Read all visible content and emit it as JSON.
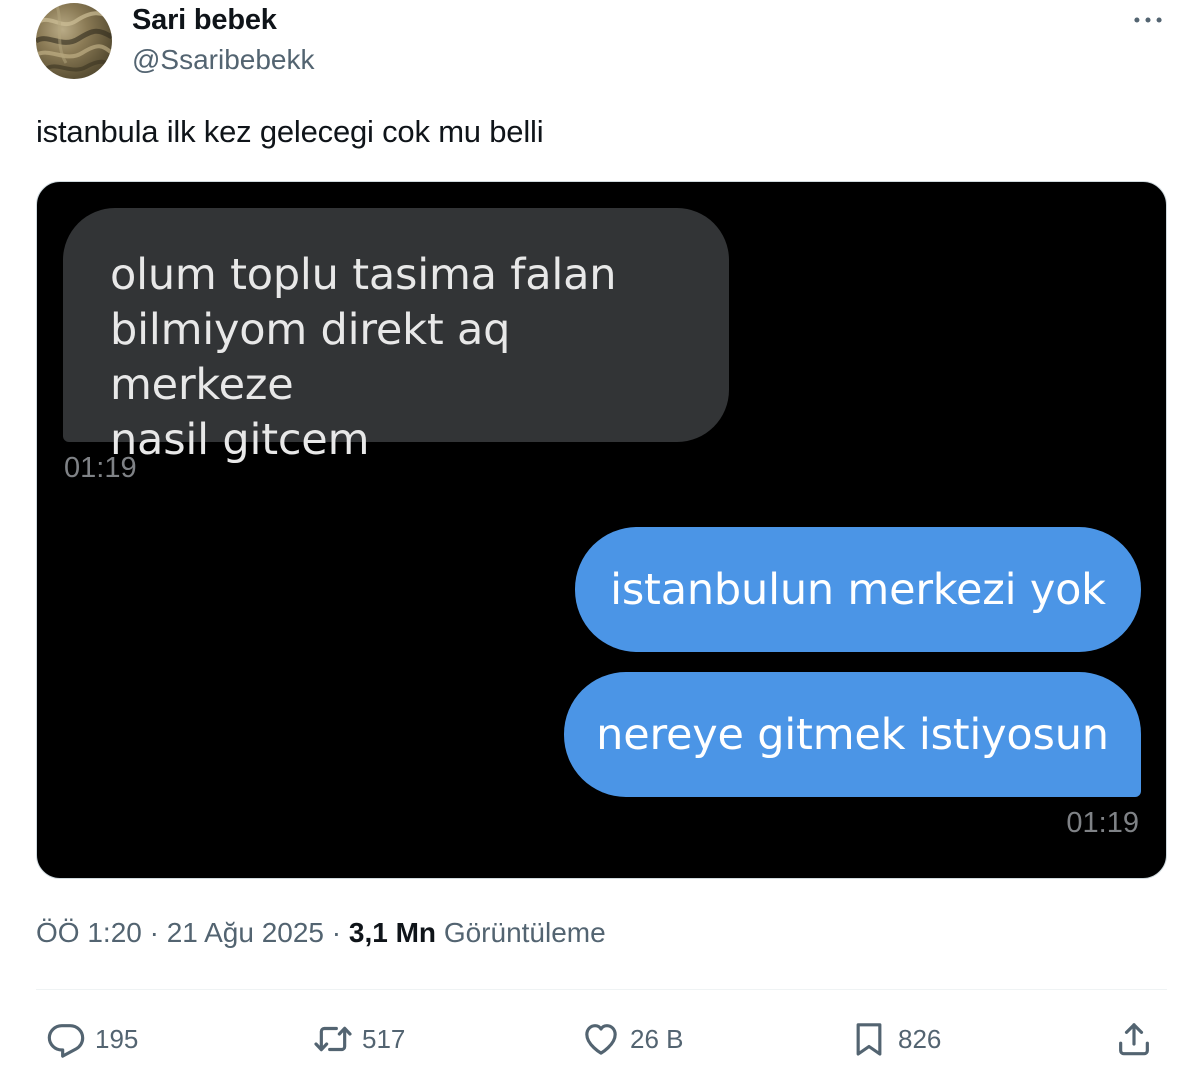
{
  "author": {
    "name": "Sari bebek",
    "handle": "@Ssaribebekk"
  },
  "tweet": {
    "text": "istanbula ilk kez gelecegi cok mu belli"
  },
  "chat": {
    "incoming": {
      "lines": [
        "olum toplu tasima falan",
        "bilmiyom direkt aq merkeze",
        "nasil gitcem"
      ],
      "time": "01:19"
    },
    "outgoing": [
      {
        "text": "istanbulun merkezi yok"
      },
      {
        "text": "nereye gitmek istiyosun"
      }
    ],
    "outgoing_time": "01:19",
    "colors": {
      "incoming_bubble": "#323436",
      "outgoing_bubble": "#4b95e6",
      "background": "#000000"
    }
  },
  "meta": {
    "time": "ÖÖ 1:20",
    "separator": "·",
    "date": "21 Ağu 2025",
    "views_count": "3,1 Mn",
    "views_label": "Görüntüleme"
  },
  "actions": {
    "replies": "195",
    "retweets": "517",
    "likes": "26 B",
    "bookmarks": "826"
  },
  "icons": [
    "more-icon",
    "reply-icon",
    "retweet-icon",
    "like-icon",
    "bookmark-icon",
    "share-icon"
  ]
}
